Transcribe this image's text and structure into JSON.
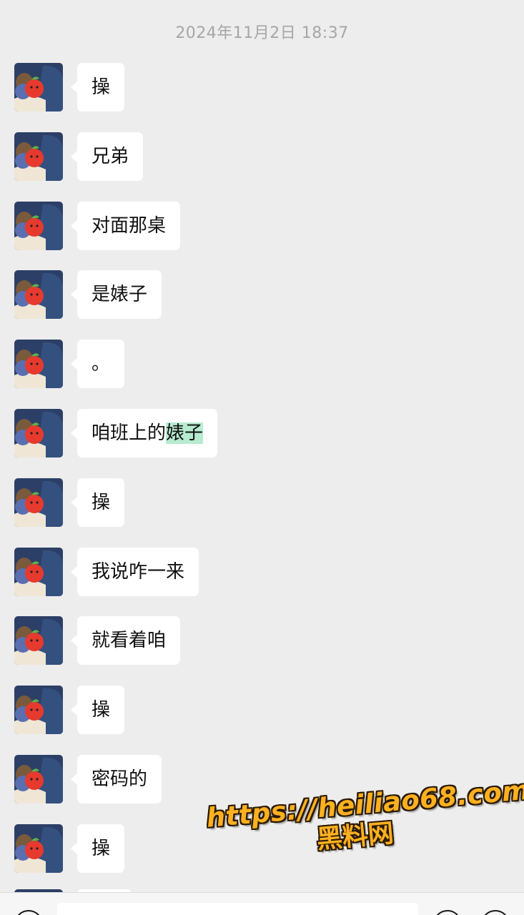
{
  "chat": {
    "timestamp": "2024年11月2日 18:37",
    "messages": [
      {
        "text": "操"
      },
      {
        "text": "兄弟"
      },
      {
        "text": "对面那桌"
      },
      {
        "text": "是婊子"
      },
      {
        "text": "。"
      },
      {
        "text_plain": "咱班上的",
        "text_highlight": "婊子"
      },
      {
        "text": "操"
      },
      {
        "text": "我说咋一来"
      },
      {
        "text": "就看着咱"
      },
      {
        "text": "操"
      },
      {
        "text": "密码的"
      },
      {
        "text": "操"
      }
    ]
  },
  "watermark": {
    "url": "https://heiliao68.com",
    "name": "黑料网"
  },
  "input_bar": {
    "voice_icon": "voice-icon",
    "emoji_icon": "emoji-icon",
    "plus_icon": "plus-icon"
  },
  "colors": {
    "background": "#ededed",
    "bubble": "#ffffff",
    "highlight": "#b7ebcf",
    "watermark_fill": "#ffb020",
    "watermark_outline": "#2a1a00"
  }
}
